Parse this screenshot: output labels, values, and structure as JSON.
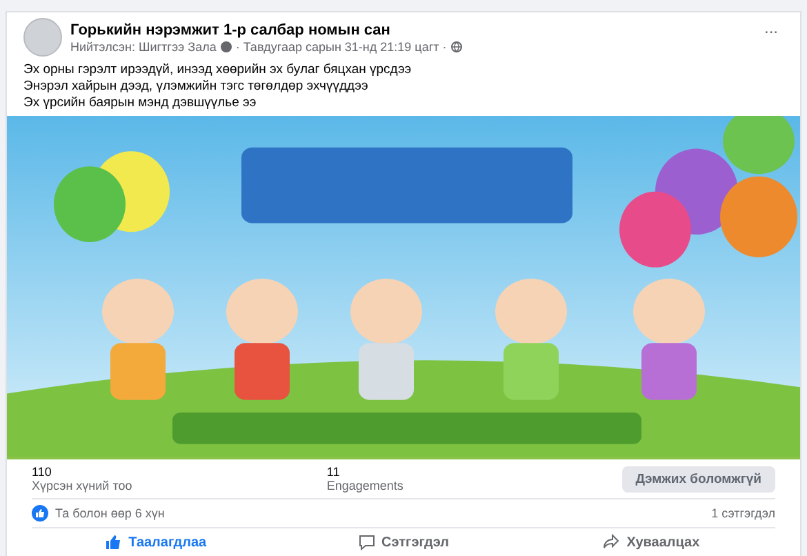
{
  "post": {
    "page_name": "Горькийн нэрэмжит 1-р салбар номын сан",
    "author": "Нийтэлсэн: Шигтгээ Зала",
    "date": "· Тавдугаар сарын 31-нд 21:19 цагт ·",
    "more": "...",
    "lines": [
      "Эх орны гэрэлт ирээдүй, инээд хөөрийн эх булаг бяцхан үрсдээ",
      "Энэрэл хайрын дээд, үлэмжийн тэгс төгөлдөр эхчүүддээ",
      "Эх үрсийн баярын мэнд дэвшүүлье ээ"
    ]
  },
  "stats": [
    {
      "value": "110",
      "label": "Хүрсэн хүний тоо"
    },
    {
      "value": "11",
      "label": "Engagements"
    }
  ],
  "boost_button": {
    "label": "Дэмжих боломжгүй",
    "disabled": true
  },
  "reactions": {
    "text": "Та болон өөр 6 хүн",
    "comments": "1 сэтгэгдэл"
  },
  "actions": [
    {
      "kind": "like",
      "label": "Таалагдлаа",
      "selected": true
    },
    {
      "kind": "comment",
      "label": "Сэтгэгдэл",
      "selected": false
    },
    {
      "kind": "share",
      "label": "Хуваалцах",
      "selected": false
    }
  ]
}
